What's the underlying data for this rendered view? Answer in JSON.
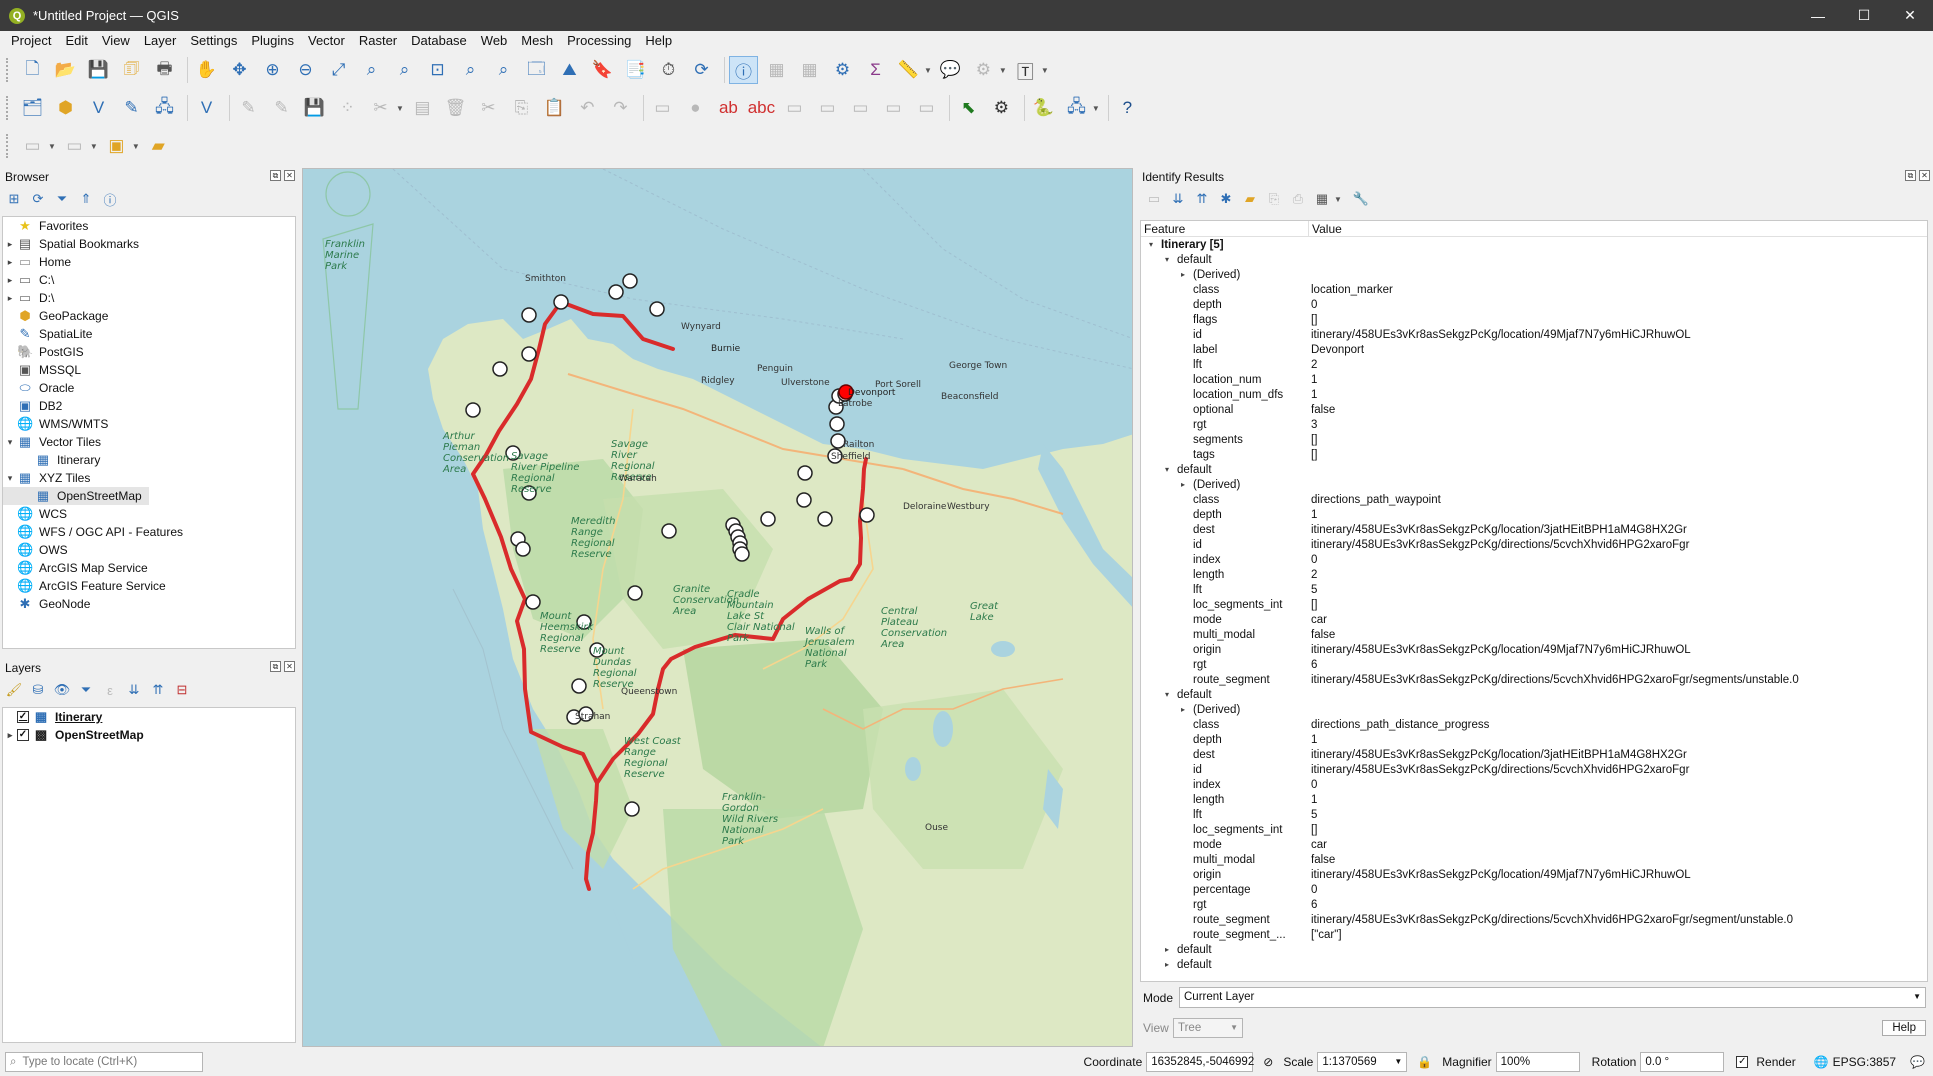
{
  "window": {
    "title": "*Untitled Project — QGIS",
    "min": "—",
    "max": "☐",
    "close": "✕"
  },
  "menu": [
    "Project",
    "Edit",
    "View",
    "Layer",
    "Settings",
    "Plugins",
    "Vector",
    "Raster",
    "Database",
    "Web",
    "Mesh",
    "Processing",
    "Help"
  ],
  "browser": {
    "title": "Browser",
    "items": [
      {
        "label": "Favorites",
        "icon": "star-icon",
        "arrow": ""
      },
      {
        "label": "Spatial Bookmarks",
        "icon": "bookmark-icon",
        "arrow": "▸"
      },
      {
        "label": "Home",
        "icon": "folder-icon",
        "arrow": "▸"
      },
      {
        "label": "C:\\",
        "icon": "drive-icon",
        "arrow": "▸"
      },
      {
        "label": "D:\\",
        "icon": "drive-icon",
        "arrow": "▸"
      },
      {
        "label": "GeoPackage",
        "icon": "geopackage-icon",
        "arrow": ""
      },
      {
        "label": "SpatiaLite",
        "icon": "spatialite-icon",
        "arrow": ""
      },
      {
        "label": "PostGIS",
        "icon": "postgis-icon",
        "arrow": ""
      },
      {
        "label": "MSSQL",
        "icon": "mssql-icon",
        "arrow": ""
      },
      {
        "label": "Oracle",
        "icon": "oracle-icon",
        "arrow": ""
      },
      {
        "label": "DB2",
        "icon": "db2-icon",
        "arrow": ""
      },
      {
        "label": "WMS/WMTS",
        "icon": "globe-icon",
        "arrow": ""
      },
      {
        "label": "Vector Tiles",
        "icon": "grid-icon",
        "arrow": "▾"
      },
      {
        "label": "Itinerary",
        "icon": "grid-icon",
        "arrow": "",
        "indent": true
      },
      {
        "label": "XYZ Tiles",
        "icon": "grid-icon",
        "arrow": "▾"
      },
      {
        "label": "OpenStreetMap",
        "icon": "grid-icon",
        "arrow": "",
        "indent": true,
        "selected": true
      },
      {
        "label": "WCS",
        "icon": "globe-icon",
        "arrow": ""
      },
      {
        "label": "WFS / OGC API - Features",
        "icon": "globe-icon",
        "arrow": ""
      },
      {
        "label": "OWS",
        "icon": "globe-icon",
        "arrow": ""
      },
      {
        "label": "ArcGIS Map Service",
        "icon": "globe-icon",
        "arrow": ""
      },
      {
        "label": "ArcGIS Feature Service",
        "icon": "globe-icon",
        "arrow": ""
      },
      {
        "label": "GeoNode",
        "icon": "geonode-icon",
        "arrow": ""
      }
    ]
  },
  "layers": {
    "title": "Layers",
    "items": [
      {
        "label": "Itinerary",
        "checked": "✓"
      },
      {
        "label": "OpenStreetMap",
        "checked": "✓"
      }
    ]
  },
  "identify": {
    "title": "Identify Results",
    "col_feature": "Feature",
    "col_value": "Value",
    "rows": [
      {
        "lvl": 0,
        "a": "▾",
        "k": "Itinerary  [5]",
        "v": "",
        "bold": true
      },
      {
        "lvl": 1,
        "a": "▾",
        "k": "default",
        "v": ""
      },
      {
        "lvl": 2,
        "a": "▸",
        "k": "(Derived)",
        "v": ""
      },
      {
        "lvl": 2,
        "a": "",
        "k": "class",
        "v": "location_marker"
      },
      {
        "lvl": 2,
        "a": "",
        "k": "depth",
        "v": "0"
      },
      {
        "lvl": 2,
        "a": "",
        "k": "flags",
        "v": "[]"
      },
      {
        "lvl": 2,
        "a": "",
        "k": "id",
        "v": "itinerary/458UEs3vKr8asSekgzPcKg/location/49Mjaf7N7y6mHiCJRhuwOL"
      },
      {
        "lvl": 2,
        "a": "",
        "k": "label",
        "v": "Devonport"
      },
      {
        "lvl": 2,
        "a": "",
        "k": "lft",
        "v": "2"
      },
      {
        "lvl": 2,
        "a": "",
        "k": "location_num",
        "v": "1"
      },
      {
        "lvl": 2,
        "a": "",
        "k": "location_num_dfs",
        "v": "1"
      },
      {
        "lvl": 2,
        "a": "",
        "k": "optional",
        "v": "false"
      },
      {
        "lvl": 2,
        "a": "",
        "k": "rgt",
        "v": "3"
      },
      {
        "lvl": 2,
        "a": "",
        "k": "segments",
        "v": "[]"
      },
      {
        "lvl": 2,
        "a": "",
        "k": "tags",
        "v": "[]"
      },
      {
        "lvl": 1,
        "a": "▾",
        "k": "default",
        "v": ""
      },
      {
        "lvl": 2,
        "a": "▸",
        "k": "(Derived)",
        "v": ""
      },
      {
        "lvl": 2,
        "a": "",
        "k": "class",
        "v": "directions_path_waypoint"
      },
      {
        "lvl": 2,
        "a": "",
        "k": "depth",
        "v": "1"
      },
      {
        "lvl": 2,
        "a": "",
        "k": "dest",
        "v": "itinerary/458UEs3vKr8asSekgzPcKg/location/3jatHEitBPH1aM4G8HX2Gr"
      },
      {
        "lvl": 2,
        "a": "",
        "k": "id",
        "v": "itinerary/458UEs3vKr8asSekgzPcKg/directions/5cvchXhvid6HPG2xaroFgr"
      },
      {
        "lvl": 2,
        "a": "",
        "k": "index",
        "v": "0"
      },
      {
        "lvl": 2,
        "a": "",
        "k": "length",
        "v": "2"
      },
      {
        "lvl": 2,
        "a": "",
        "k": "lft",
        "v": "5"
      },
      {
        "lvl": 2,
        "a": "",
        "k": "loc_segments_int",
        "v": "[]"
      },
      {
        "lvl": 2,
        "a": "",
        "k": "mode",
        "v": "car"
      },
      {
        "lvl": 2,
        "a": "",
        "k": "multi_modal",
        "v": "false"
      },
      {
        "lvl": 2,
        "a": "",
        "k": "origin",
        "v": "itinerary/458UEs3vKr8asSekgzPcKg/location/49Mjaf7N7y6mHiCJRhuwOL"
      },
      {
        "lvl": 2,
        "a": "",
        "k": "rgt",
        "v": "6"
      },
      {
        "lvl": 2,
        "a": "",
        "k": "route_segment",
        "v": "itinerary/458UEs3vKr8asSekgzPcKg/directions/5cvchXhvid6HPG2xaroFgr/segments/unstable.0"
      },
      {
        "lvl": 1,
        "a": "▾",
        "k": "default",
        "v": ""
      },
      {
        "lvl": 2,
        "a": "▸",
        "k": "(Derived)",
        "v": ""
      },
      {
        "lvl": 2,
        "a": "",
        "k": "class",
        "v": "directions_path_distance_progress"
      },
      {
        "lvl": 2,
        "a": "",
        "k": "depth",
        "v": "1"
      },
      {
        "lvl": 2,
        "a": "",
        "k": "dest",
        "v": "itinerary/458UEs3vKr8asSekgzPcKg/location/3jatHEitBPH1aM4G8HX2Gr"
      },
      {
        "lvl": 2,
        "a": "",
        "k": "id",
        "v": "itinerary/458UEs3vKr8asSekgzPcKg/directions/5cvchXhvid6HPG2xaroFgr"
      },
      {
        "lvl": 2,
        "a": "",
        "k": "index",
        "v": "0"
      },
      {
        "lvl": 2,
        "a": "",
        "k": "length",
        "v": "1"
      },
      {
        "lvl": 2,
        "a": "",
        "k": "lft",
        "v": "5"
      },
      {
        "lvl": 2,
        "a": "",
        "k": "loc_segments_int",
        "v": "[]"
      },
      {
        "lvl": 2,
        "a": "",
        "k": "mode",
        "v": "car"
      },
      {
        "lvl": 2,
        "a": "",
        "k": "multi_modal",
        "v": "false"
      },
      {
        "lvl": 2,
        "a": "",
        "k": "origin",
        "v": "itinerary/458UEs3vKr8asSekgzPcKg/location/49Mjaf7N7y6mHiCJRhuwOL"
      },
      {
        "lvl": 2,
        "a": "",
        "k": "percentage",
        "v": "0"
      },
      {
        "lvl": 2,
        "a": "",
        "k": "rgt",
        "v": "6"
      },
      {
        "lvl": 2,
        "a": "",
        "k": "route_segment",
        "v": "itinerary/458UEs3vKr8asSekgzPcKg/directions/5cvchXhvid6HPG2xaroFgr/segment/unstable.0"
      },
      {
        "lvl": 2,
        "a": "",
        "k": "route_segment_...",
        "v": "[\"car\"]"
      },
      {
        "lvl": 1,
        "a": "▸",
        "k": "default",
        "v": ""
      },
      {
        "lvl": 1,
        "a": "▸",
        "k": "default",
        "v": ""
      }
    ],
    "mode_label": "Mode",
    "mode_value": "Current Layer",
    "view_label": "View",
    "view_value": "Tree",
    "help": "Help"
  },
  "map_labels": [
    {
      "t": "Franklin\nMarine\nPark",
      "c": "#2c7a4b"
    },
    {
      "t": "Smithton",
      "c": "#333"
    },
    {
      "t": "Wynyard",
      "c": "#333"
    },
    {
      "t": "Burnie",
      "c": "#222"
    },
    {
      "t": "Penguin",
      "c": "#333"
    },
    {
      "t": "Ulverstone",
      "c": "#333"
    },
    {
      "t": "Ridgley",
      "c": "#333"
    },
    {
      "t": "Devonport",
      "c": "#222"
    },
    {
      "t": "Port Sorell",
      "c": "#333"
    },
    {
      "t": "George Town",
      "c": "#333"
    },
    {
      "t": "Beaconsfield",
      "c": "#333"
    },
    {
      "t": "Latrobe",
      "c": "#333"
    },
    {
      "t": "Railton",
      "c": "#333"
    },
    {
      "t": "Sheffield",
      "c": "#333"
    },
    {
      "t": "Deloraine",
      "c": "#333"
    },
    {
      "t": "Westbury",
      "c": "#333"
    },
    {
      "t": "Arthur\nPieman\nConservation\nArea",
      "c": "#2c7a4b"
    },
    {
      "t": "Savage\nRiver Pipeline\nRegional\nReserve",
      "c": "#2c7a4b"
    },
    {
      "t": "Savage\nRiver\nRegional\nReserve",
      "c": "#2c7a4b"
    },
    {
      "t": "Waratah",
      "c": "#333"
    },
    {
      "t": "Meredith\nRange\nRegional\nReserve",
      "c": "#2c7a4b"
    },
    {
      "t": "Granite\nConservation\nArea",
      "c": "#2c7a4b"
    },
    {
      "t": "Cradle\nMountain\nLake St\nClair National\nPark",
      "c": "#2c7a4b"
    },
    {
      "t": "Walls of\nJerusalem\nNational\nPark",
      "c": "#2c7a4b"
    },
    {
      "t": "Central\nPlateau\nConservation\nArea",
      "c": "#2c7a4b"
    },
    {
      "t": "Mount\nHeemskirk\nRegional\nReserve",
      "c": "#2c7a4b"
    },
    {
      "t": "Mount\nDundas\nRegional\nReserve",
      "c": "#2c7a4b"
    },
    {
      "t": "Queenstown",
      "c": "#333"
    },
    {
      "t": "Strahan",
      "c": "#333"
    },
    {
      "t": "West Coast\nRange\nRegional\nReserve",
      "c": "#2c7a4b"
    },
    {
      "t": "Franklin-\nGordon\nWild Rivers\nNational\nPark",
      "c": "#2c7a4b"
    },
    {
      "t": "Great\nLake",
      "c": "#2c7a4b"
    },
    {
      "t": "Ouse",
      "c": "#333"
    }
  ],
  "status": {
    "locate_placeholder": "Type to locate (Ctrl+K)",
    "coordinate_label": "Coordinate",
    "coordinate_value": "16352845,-5046992",
    "scale_label": "Scale",
    "scale_value": "1:1370569",
    "magnifier_label": "Magnifier",
    "magnifier_value": "100%",
    "rotation_label": "Rotation",
    "rotation_value": "0.0 °",
    "render_label": "Render",
    "epsg": "EPSG:3857"
  },
  "colors": {
    "route": "#d92b2b",
    "selected_marker": "#ff0000",
    "sea": "#aad3df",
    "land": "#dde8c4"
  }
}
